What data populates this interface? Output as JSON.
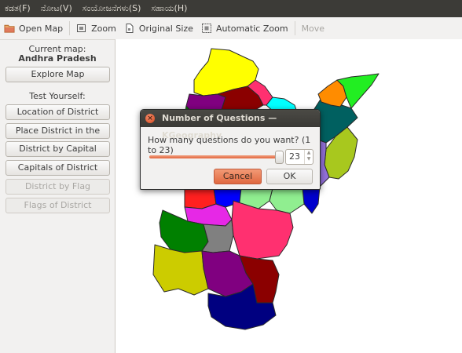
{
  "menubar": {
    "items": [
      "ಕಡತ(F)",
      "ನೋಟ(V)",
      "ಸಂಯೋಜನೆಗಳು(S)",
      "ಸಹಾಯ(H)"
    ]
  },
  "toolbar": {
    "open_map": "Open Map",
    "zoom": "Zoom",
    "original_size": "Original Size",
    "automatic_zoom": "Automatic Zoom",
    "move": "Move"
  },
  "sidebar": {
    "current_map_label": "Current map:",
    "current_map_name": "Andhra Pradesh",
    "explore_map": "Explore Map",
    "test_yourself": "Test Yourself:",
    "location_of_district": "Location of District",
    "place_district": "Place District in the Map",
    "district_by_capital": "District by Capital",
    "capitals_of_district": "Capitals of District",
    "district_by_flag": "District by Flag",
    "flags_of_district": "Flags of District"
  },
  "dialog": {
    "title": "Number of Questions — KGeography",
    "question": "How many questions do you want? (1 to 23)",
    "value": "23",
    "slider_fraction": 1.0,
    "cancel": "Cancel",
    "ok": "OK"
  },
  "colors": {
    "accent": "#e2633a",
    "menubar_bg": "#3c3b37",
    "window_bg": "#f2f1f0"
  }
}
